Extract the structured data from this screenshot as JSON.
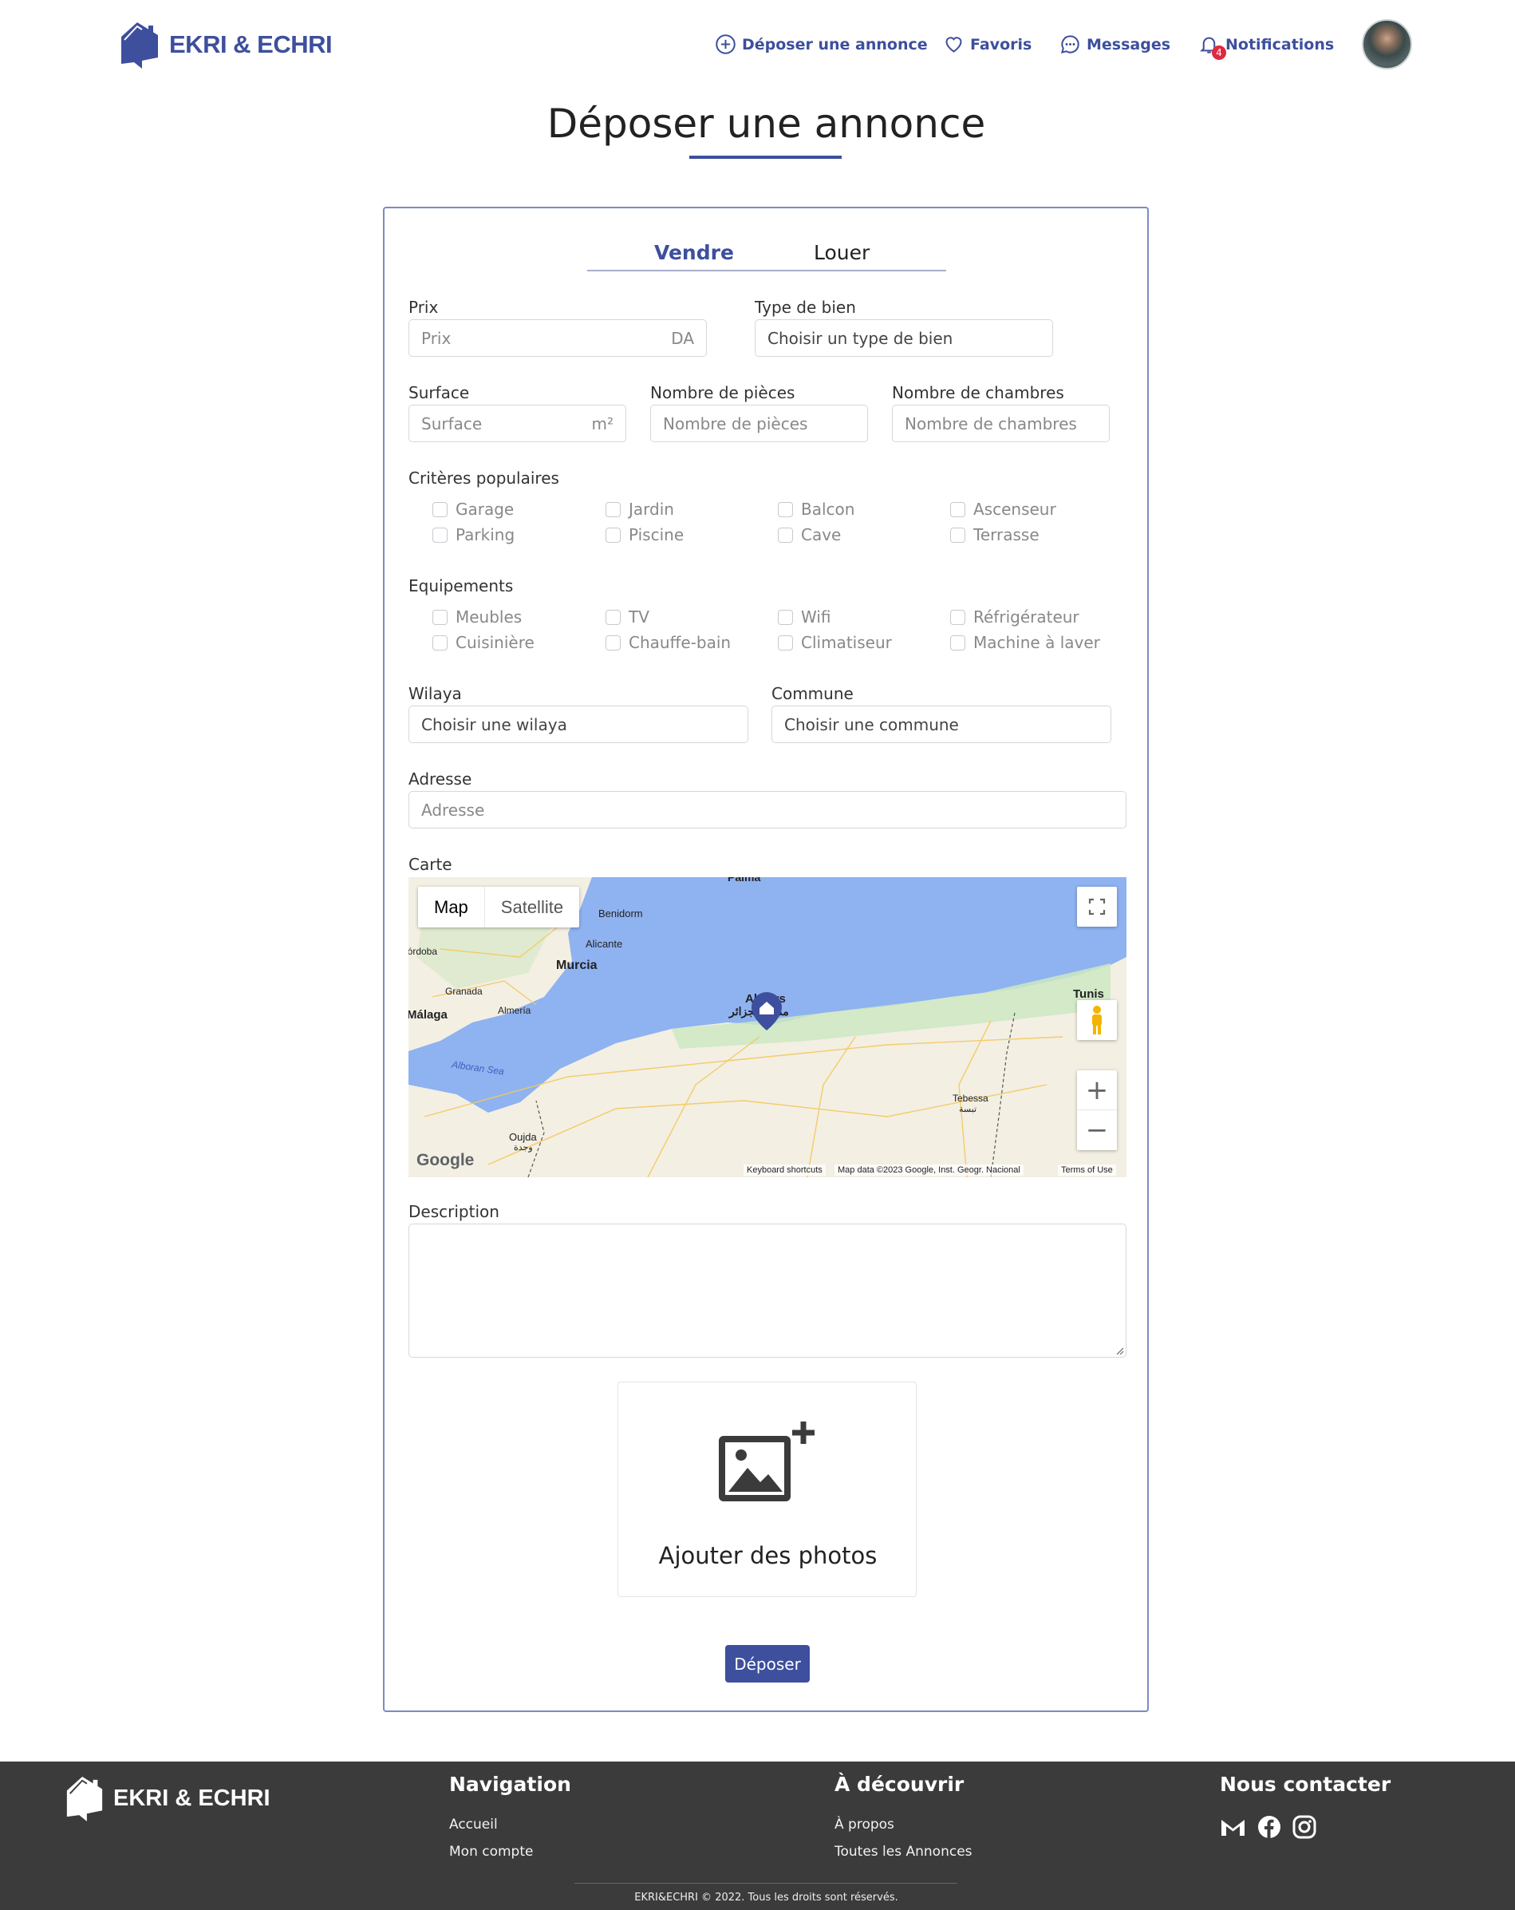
{
  "header": {
    "logo_text": "EKRI & ECHRI",
    "nav": {
      "post_ad": "Déposer une annonce",
      "favorites": "Favoris",
      "messages": "Messages",
      "notifications": "Notifications",
      "notifications_count": "4"
    }
  },
  "page": {
    "title": "Déposer une annonce"
  },
  "form": {
    "tabs": [
      "Vendre",
      "Louer"
    ],
    "active_tab": "Vendre",
    "prix": {
      "label": "Prix",
      "placeholder": "Prix",
      "suffix": "DA"
    },
    "type_bien": {
      "label": "Type de bien",
      "value": "Choisir un type de bien"
    },
    "surface": {
      "label": "Surface",
      "placeholder": "Surface",
      "suffix": "m²"
    },
    "pieces": {
      "label": "Nombre de pièces",
      "placeholder": "Nombre de pièces"
    },
    "chambres": {
      "label": "Nombre de chambres",
      "placeholder": "Nombre de chambres"
    },
    "criteres": {
      "label": "Critères populaires",
      "items": [
        "Garage",
        "Jardin",
        "Balcon",
        "Ascenseur",
        "Parking",
        "Piscine",
        "Cave",
        "Terrasse"
      ]
    },
    "equipements": {
      "label": "Equipements",
      "items": [
        "Meubles",
        "TV",
        "Wifi",
        "Réfrigérateur",
        "Cuisinière",
        "Chauffe-bain",
        "Climatiseur",
        "Machine à laver"
      ]
    },
    "wilaya": {
      "label": "Wilaya",
      "value": "Choisir une wilaya"
    },
    "commune": {
      "label": "Commune",
      "value": "Choisir une commune"
    },
    "adresse": {
      "label": "Adresse",
      "placeholder": "Adresse"
    },
    "carte": {
      "label": "Carte",
      "map_button": "Map",
      "satellite_button": "Satellite",
      "zoom_in": "+",
      "zoom_out": "−",
      "places": [
        "Palma",
        "Benidorm",
        "Alicante",
        "Murcia",
        "Córdoba",
        "Granada",
        "Málaga",
        "Almería",
        "Alboran Sea",
        "Oujda",
        "وجدة",
        "Algiers",
        "مدينة الجزائر",
        "Tunis",
        "Tebessa",
        "تبسة"
      ],
      "attribution": {
        "google": "Google",
        "shortcuts": "Keyboard shortcuts",
        "data": "Map data ©2023 Google, Inst. Geogr. Nacional",
        "terms": "Terms of Use"
      }
    },
    "description": {
      "label": "Description"
    },
    "photos": {
      "label": "Ajouter des photos"
    },
    "submit": "Déposer"
  },
  "footer": {
    "logo_text": "EKRI & ECHRI",
    "navigation": {
      "title": "Navigation",
      "links": [
        "Accueil",
        "Mon compte"
      ]
    },
    "discover": {
      "title": "À découvrir",
      "links": [
        "À propos",
        "Toutes les Annonces"
      ]
    },
    "contact": {
      "title": "Nous contacter",
      "icons": [
        "gmail-icon",
        "facebook-icon",
        "instagram-icon"
      ]
    },
    "copyright": "EKRI&ECHRI © 2022. Tous les droits sont réservés."
  },
  "colors": {
    "brand": "#3d4f9d",
    "footer_bg": "#3b3b3b",
    "badge": "#e0283e"
  }
}
